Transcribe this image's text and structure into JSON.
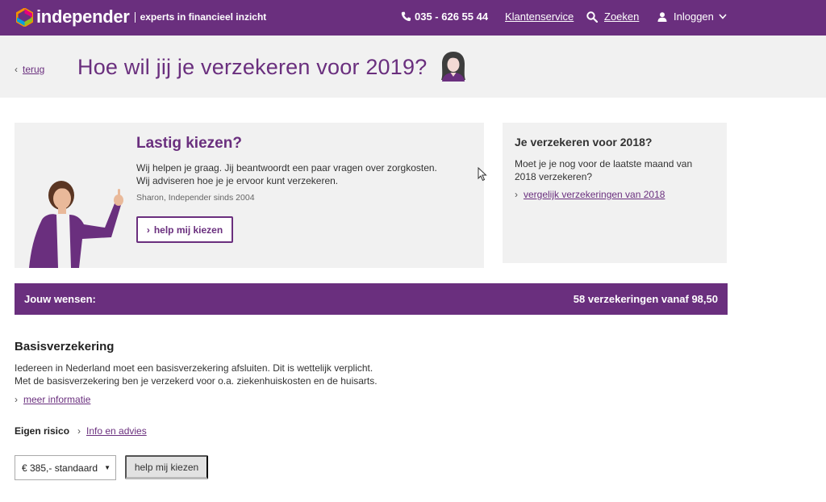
{
  "header": {
    "brand": "independer",
    "tagline": "experts in financieel inzicht",
    "phone": "035 - 626 55 44",
    "klantenservice": "Klantenservice",
    "zoeken": "Zoeken",
    "inloggen": "Inloggen"
  },
  "titlebar": {
    "back": "terug",
    "title": "Hoe wil jij je verzekeren voor 2019?"
  },
  "help_card": {
    "title": "Lastig kiezen?",
    "text_line1": "Wij helpen je graag. Jij beantwoordt een paar vragen over zorgkosten.",
    "text_line2": "Wij adviseren hoe je je ervoor kunt verzekeren.",
    "signature": "Sharon, Independer sinds 2004",
    "button": "help mij kiezen"
  },
  "card_2018": {
    "title": "Je verzekeren voor 2018?",
    "text": "Moet je je nog voor de laatste maand van 2018 verzekeren?",
    "link": "vergelijk verzekeringen van 2018"
  },
  "wishes": {
    "label": "Jouw wensen:",
    "result": "58 verzekeringen vanaf 98,50"
  },
  "basis": {
    "title": "Basisverzekering",
    "text_line1": "Iedereen in Nederland moet een basisverzekering afsluiten. Dit is wettelijk verplicht.",
    "text_line2": "Met de basisverzekering ben je verzekerd voor o.a. ziekenhuiskosten en de huisarts.",
    "more_link": "meer informatie",
    "eigen_risico_label": "Eigen risico",
    "info_link": "Info en advies",
    "select_value": "€ 385,- standaard",
    "help_button": "help mij kiezen"
  },
  "colors": {
    "brand_purple": "#6a2f7e",
    "panel_grey": "#f1f1f1"
  }
}
